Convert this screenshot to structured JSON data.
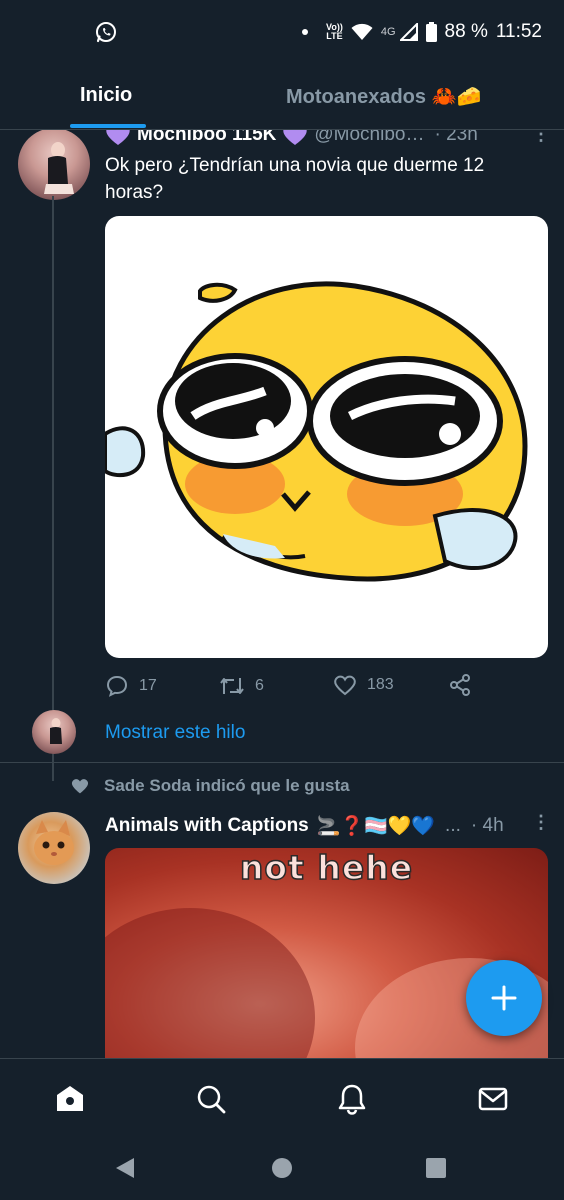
{
  "status_bar": {
    "volte_line1": "Vo))",
    "volte_line2": "LTE",
    "network": "4G",
    "battery": "88 %",
    "time": "11:52"
  },
  "tabs": [
    {
      "label": "Inicio",
      "active": true
    },
    {
      "label": "Motoanexados",
      "emoji": "🦀🧀",
      "active": false
    }
  ],
  "tweet1": {
    "name": "Mochiboo 115K",
    "handle": "@Mochibo…",
    "time": "· 23h",
    "text": "Ok pero ¿Tendrían una novia que duerme 12 horas?",
    "replies": "17",
    "retweets": "6",
    "likes": "183"
  },
  "show_thread_label": "Mostrar este hilo",
  "liked_by": "Sade Soda indicó que le gusta",
  "tweet2": {
    "name": "Animals with Captions",
    "emojis": "🚬❓🏳️‍⚧️💛💙",
    "ellipsis": "...",
    "time": "· 4h",
    "image_caption": "not hehe"
  },
  "colors": {
    "background": "#15202b",
    "accent": "#1d9bf0",
    "secondary_text": "#8899a6",
    "divider": "#38444d"
  },
  "icons": {
    "status_left": "whatsapp-icon",
    "nav": [
      "home-icon",
      "search-icon",
      "bell-icon",
      "mail-icon"
    ],
    "system_nav": [
      "back-icon",
      "home-circle-icon",
      "recents-icon"
    ]
  }
}
